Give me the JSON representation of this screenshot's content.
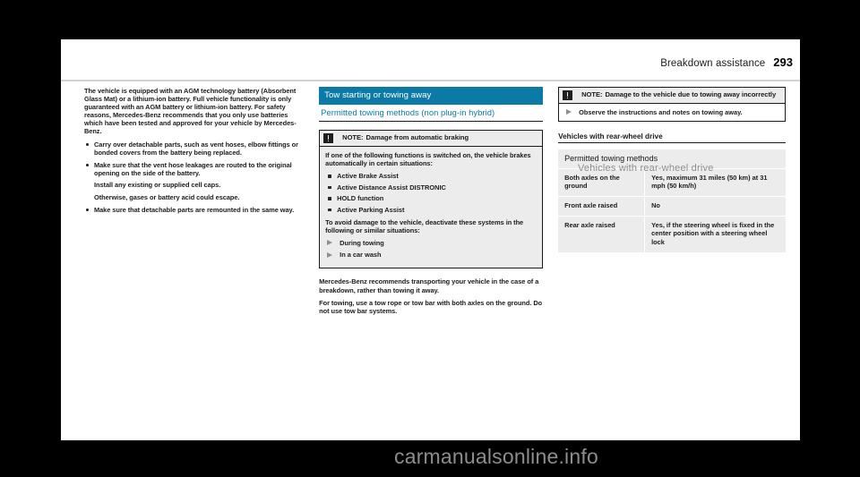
{
  "running_head": {
    "chapter": "Breakdown assistance",
    "page_number": "293"
  },
  "colors": {
    "accent_teal": "#0b7aa6",
    "page_background": "#ffffff",
    "viewer_background": "#000000",
    "box_fill": "#ececec",
    "rule": "#d2d2d2",
    "watermark": "#8d8d8d"
  },
  "column_left": {
    "intro": "The vehicle is equipped with an AGM technology battery (Absorbent Glass Mat) or a lithium-ion battery. Full vehicle functionality is only guaranteed with an AGM battery or lithium-ion battery. For safety reasons, Mercedes-Benz recommends that you only use batteries which have been tested and approved for your vehicle by Mercedes-Benz.",
    "bullets": [
      {
        "text": "Carry over detachable parts, such as vent hoses, elbow fittings or bonded covers from the battery being replaced.",
        "sub": []
      },
      {
        "text": "Make sure that the vent hose leakages are routed to the original opening on the side of the battery.",
        "sub": [
          "Install any existing or supplied cell caps.",
          "Otherwise, gases or battery acid could escape."
        ]
      },
      {
        "text": "Make sure that detachable parts are remounted in the same way.",
        "sub": []
      }
    ]
  },
  "column_middle": {
    "section_title": "Tow starting or towing away",
    "subsection_title": "Permitted towing methods (non plug-in hybrid)",
    "note": {
      "icon": "note-warning-icon",
      "label": "NOTE:",
      "title": "Damage from automatic braking",
      "intro": "If one of the following functions is switched on, the vehicle brakes automatically in certain situations:",
      "functions": [
        "Active Brake Assist",
        "Active Distance Assist DISTRONIC",
        "HOLD function",
        "Active Parking Assist"
      ],
      "outro": "To avoid damage to the vehicle, deactivate these systems in the following or similar situations:",
      "steps": [
        "During towing",
        "In a car wash"
      ]
    },
    "paragraphs": [
      "Mercedes-Benz recommends transporting your vehicle in the case of a breakdown, rather than towing it away.",
      "For towing, use a tow rope or tow bar with both axles on the ground. Do not use tow bar systems."
    ]
  },
  "column_right": {
    "note": {
      "icon": "note-warning-icon",
      "label": "NOTE:",
      "title": "Damage to the vehicle due to towing away incorrectly",
      "steps": [
        "Observe the instructions and notes on towing away."
      ]
    },
    "heading": "Vehicles with rear-wheel drive",
    "table": {
      "caption": "Permitted towing methods",
      "rows": [
        {
          "method": "Both axles on the ground",
          "permitted": "Yes, maximum 31 miles (50 km) at 31 mph (50 km/h)"
        },
        {
          "method": "Front axle raised",
          "permitted": "No"
        },
        {
          "method": "Rear axle raised",
          "permitted": "Yes, if the steering wheel is fixed in the center position with a steering wheel lock"
        }
      ]
    }
  },
  "watermark": {
    "text": "carmanualsonline.info",
    "overlay_heading": "Vehicles with rear-wheel drive"
  }
}
